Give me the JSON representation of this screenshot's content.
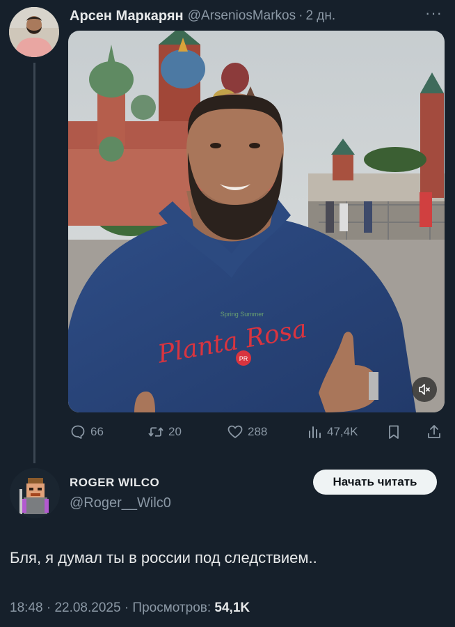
{
  "tweet": {
    "author_name": "Арсен Маркарян",
    "author_handle": "@ArseniosMarkos",
    "separator": "·",
    "time_ago": "2 дн.",
    "more_label": "···",
    "stats": {
      "replies": "66",
      "reposts": "20",
      "likes": "288",
      "views": "47,4K"
    },
    "media": {
      "hoodie_text": "Planta Rosa",
      "hoodie_small": "Spring Summer",
      "badge_text": "PR"
    }
  },
  "reply": {
    "author_name": "ROGER WILCO",
    "author_handle": "@Roger__Wilc0",
    "follow_label": "Начать читать",
    "text": "Бля, я думал ты в россии под следствием..",
    "time": "18:48",
    "date": "22.08.2025",
    "views_label": "Просмотров:",
    "views_count": "54,1K",
    "separator": "·"
  },
  "colors": {
    "background": "#16202b",
    "text": "#e7e9ea",
    "muted": "#8b98a5"
  }
}
